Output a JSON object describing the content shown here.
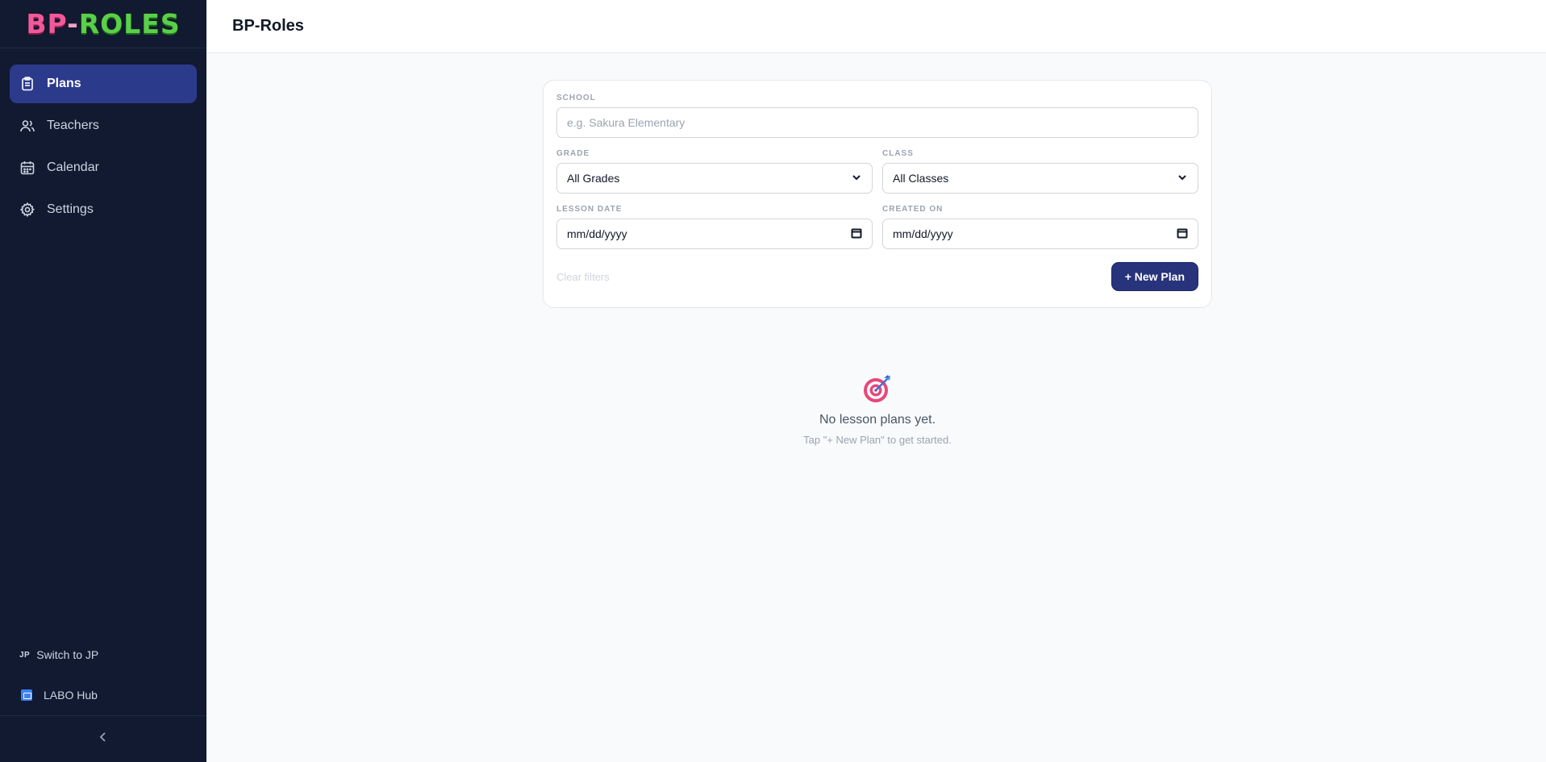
{
  "app": {
    "logo_text_left": "BP",
    "logo_text_dash": "-",
    "logo_text_right": "ROLES",
    "title": "BP-Roles"
  },
  "sidebar": {
    "items": [
      {
        "label": "Plans",
        "icon": "clipboard-icon",
        "active": true
      },
      {
        "label": "Teachers",
        "icon": "users-icon",
        "active": false
      },
      {
        "label": "Calendar",
        "icon": "calendar-icon",
        "active": false
      },
      {
        "label": "Settings",
        "icon": "gear-icon",
        "active": false
      }
    ],
    "switch_lang_badge": "JP",
    "switch_lang_label": "Switch to JP",
    "hub_label": "LABO Hub"
  },
  "filters": {
    "school_label": "SCHOOL",
    "school_placeholder": "e.g. Sakura Elementary",
    "grade_label": "GRADE",
    "grade_value": "All Grades",
    "class_label": "CLASS",
    "class_value": "All Classes",
    "lesson_date_label": "LESSON DATE",
    "lesson_date_value": "mm/dd/yyyy",
    "created_on_label": "CREATED ON",
    "created_on_value": "mm/dd/yyyy",
    "clear_label": "Clear filters",
    "new_plan_label": "+ New Plan"
  },
  "empty_state": {
    "icon": "target-icon",
    "title": "No lesson plans yet.",
    "subtitle": "Tap \"+ New Plan\" to get started."
  },
  "colors": {
    "sidebar_bg": "#111a30",
    "active_nav": "#2c3a8c",
    "primary_button": "#27337a"
  }
}
